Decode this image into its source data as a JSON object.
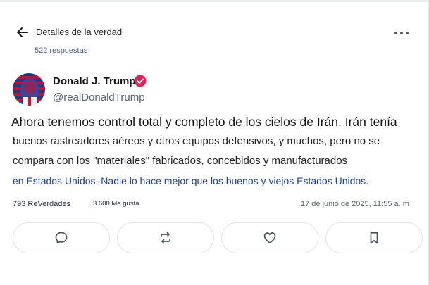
{
  "header": {
    "title": "Detalles de la verdad",
    "subtitle": "522 respuestas",
    "back_icon": "arrow-left-icon",
    "more_icon": "more-horizontal-icon"
  },
  "author": {
    "name": "Donald J. Trump",
    "handle": "@realDonaldTrump",
    "verified_icon": "verified-badge-icon",
    "verified_color": "#e0245e"
  },
  "post": {
    "line1": "Ahora tenemos control total y completo de los cielos de Irán. Irán tenía",
    "line2": "buenos rastreadores aéreos y otros equipos defensivos, y muchos, pero no se",
    "line3": "compara con los \"materiales\" fabricados, concebidos y manufacturados",
    "line4": "en Estados Unidos. Nadie lo hace mejor que los buenos y viejos Estados Unidos."
  },
  "stats": {
    "reverdades": "793 ReVerdades",
    "likes": "3.600 Me gusta",
    "date": "17 de junio de 2025, 11:55 a. m"
  },
  "actions": {
    "reply_icon": "reply-bubble-icon",
    "retruth_icon": "retruth-icon",
    "like_icon": "heart-icon",
    "bookmark_icon": "bookmark-icon"
  }
}
